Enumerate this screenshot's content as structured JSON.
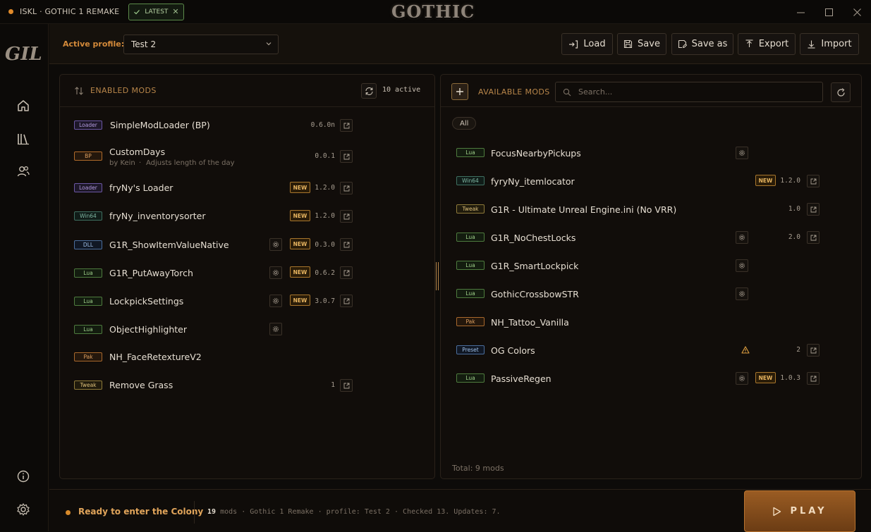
{
  "titlebar": {
    "app_title": "ISKL · GOTHIC 1 REMAKE",
    "latest_badge": "LATEST",
    "logo_text": "GOTHIC"
  },
  "sidebar": {
    "logo_text": "GIL",
    "nav": [
      "home-icon",
      "library-icon",
      "users-icon"
    ],
    "bottom": [
      "info-icon",
      "gear-icon"
    ]
  },
  "toolbar": {
    "active_profile_label": "Active profile:",
    "profile_value": "Test 2",
    "buttons": {
      "load": "Load",
      "save": "Save",
      "save_as": "Save as",
      "export": "Export",
      "import": "Import"
    }
  },
  "enabled": {
    "title": "ENABLED MODS",
    "active_count": "10 active",
    "mods": [
      {
        "tag": "Loader",
        "name": "SimpleModLoader (BP)",
        "version": "0.6.0n"
      },
      {
        "tag": "BP",
        "name": "CustomDays",
        "author": "by Kein",
        "desc": "Adjusts length of the day",
        "version": "0.0.1"
      },
      {
        "tag": "Loader",
        "name": "fryNy's Loader",
        "new": "NEW",
        "version": "1.2.0"
      },
      {
        "tag": "Win64",
        "name": "fryNy_inventorysorter",
        "new": "NEW",
        "version": "1.2.0"
      },
      {
        "tag": "DLL",
        "name": "G1R_ShowItemValueNative",
        "new": "NEW",
        "version": "0.3.0"
      },
      {
        "tag": "Lua",
        "name": "G1R_PutAwayTorch",
        "new": "NEW",
        "version": "0.6.2"
      },
      {
        "tag": "Lua",
        "name": "LockpickSettings",
        "new": "NEW",
        "version": "3.0.7"
      },
      {
        "tag": "Lua",
        "name": "ObjectHighlighter"
      },
      {
        "tag": "Pak",
        "name": "NH_FaceRetextureV2"
      },
      {
        "tag": "Tweak",
        "name": "Remove Grass",
        "version": "1"
      }
    ]
  },
  "available": {
    "title": "AVAILABLE MODS",
    "search_placeholder": "Search...",
    "filter_all": "All",
    "total": "Total: 9 mods",
    "mods": [
      {
        "tag": "Lua",
        "name": "FocusNearbyPickups"
      },
      {
        "tag": "Win64",
        "name": "fyryNy_itemlocator",
        "new": "NEW",
        "version": "1.2.0"
      },
      {
        "tag": "Tweak",
        "name": "G1R - Ultimate Unreal Engine.ini (No VRR)",
        "version": "1.0"
      },
      {
        "tag": "Lua",
        "name": "G1R_NoChestLocks",
        "version": "2.0"
      },
      {
        "tag": "Lua",
        "name": "G1R_SmartLockpick"
      },
      {
        "tag": "Lua",
        "name": "GothicCrossbowSTR"
      },
      {
        "tag": "Pak",
        "name": "NH_Tattoo_Vanilla"
      },
      {
        "tag": "Preset",
        "name": "OG Colors",
        "version": "2"
      },
      {
        "tag": "Lua",
        "name": "PassiveRegen",
        "new": "NEW",
        "version": "1.0.3"
      }
    ]
  },
  "status": {
    "ready": "Ready to enter the Colony",
    "mods_count": "19",
    "mods_word": "mods",
    "game": "Gothic 1 Remake",
    "profile": "profile: Test 2",
    "checked": "Checked 13.",
    "updates": "Updates: 7.",
    "play": "PLAY"
  },
  "colors": {
    "accent": "#d48a3a",
    "background": "#0d0b09",
    "play": "#8a5220"
  }
}
